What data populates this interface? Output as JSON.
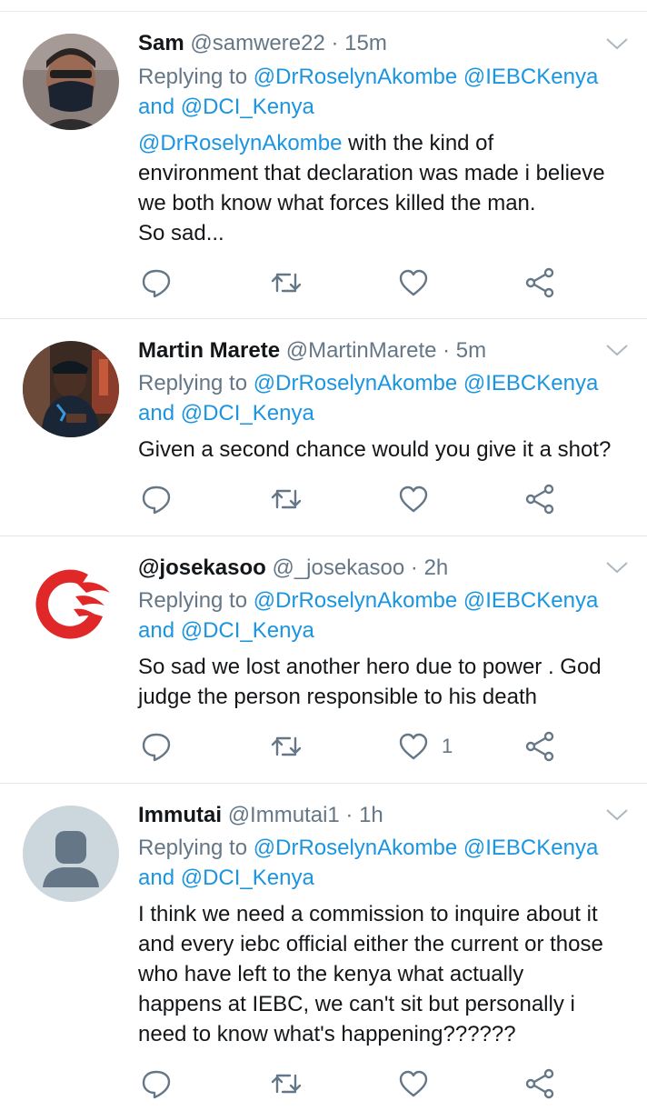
{
  "colors": {
    "link": "#1b95e0",
    "muted": "#657786",
    "text": "#14171a",
    "divider": "#e1e8ed"
  },
  "tweets": [
    {
      "name": "Sam",
      "handle": "@samwere22",
      "dot": " · ",
      "time": "15m",
      "replying_prefix": "Replying to ",
      "mention1": "@DrRoselynAkombe",
      "mention2": " @IEBCKenya",
      "and": "and ",
      "mention3": "@DCI_Kenya",
      "body_mention": "@DrRoselynAkombe",
      "body": [
        " with the kind of",
        "environment that declaration was made i believe",
        "we both know what forces killed the man.",
        "So sad..."
      ],
      "like_count": "",
      "avatar_icon": "masked-person-avatar"
    },
    {
      "name": "Martin Marete",
      "handle": "@MartinMarete",
      "dot": " · ",
      "time": "5m",
      "replying_prefix": "Replying to ",
      "mention1": "@DrRoselynAkombe",
      "mention2": " @IEBCKenya",
      "and": "and ",
      "mention3": "@DCI_Kenya",
      "body": [
        "Given a second chance would you give it a shot?"
      ],
      "like_count": "",
      "avatar_icon": "person-photo-avatar"
    },
    {
      "name": "@josekasoo",
      "handle": "@_josekasoo",
      "dot": " · ",
      "time": "2h",
      "replying_prefix": "Replying to ",
      "mention1": "@DrRoselynAkombe",
      "mention2": " @IEBCKenya",
      "and": "and ",
      "mention3": "@DCI_Kenya",
      "body": [
        "So sad we lost another hero due to power . God",
        "judge the person responsible to his death"
      ],
      "like_count": "1",
      "avatar_icon": "red-swirl-logo-avatar"
    },
    {
      "name": "Immutai",
      "handle": "@Immutai1",
      "dot": " · ",
      "time": "1h",
      "replying_prefix": "Replying to ",
      "mention1": "@DrRoselynAkombe",
      "mention2": " @IEBCKenya",
      "and": "and ",
      "mention3": "@DCI_Kenya",
      "body": [
        "I think we need a commission to inquire about it",
        "and every iebc official either the current or those",
        "who have left to the kenya what actually",
        "happens at IEBC, we can't sit but personally i",
        "need to know what's happening??????"
      ],
      "like_count": "",
      "avatar_icon": "default-profile-avatar"
    }
  ]
}
